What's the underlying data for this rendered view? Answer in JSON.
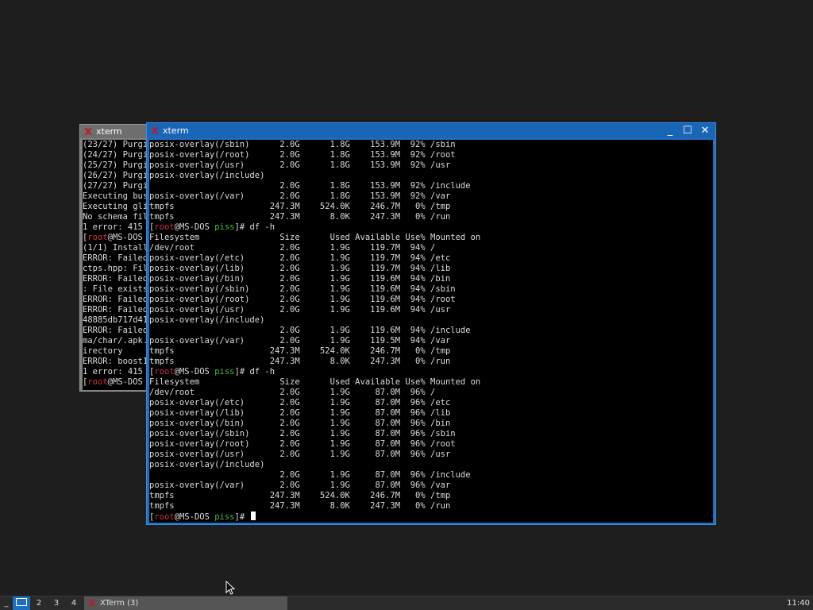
{
  "back_window": {
    "title": "xterm",
    "lines": [
      "(23/27) Purgi",
      "(24/27) Purgi",
      "(25/27) Purgi",
      "(26/27) Purgi",
      "(27/27) Purgi",
      "Executing bus",
      "Executing gli",
      "No schema fil",
      "1 error: 415",
      "[root@MS-DOS",
      "(1/1) Install",
      "ERROR: Failed",
      "ctps.hpp: Fil",
      "ERROR: Failed",
      ": File exists",
      "ERROR: Failed",
      "ERROR: Failed",
      "48885db717d41",
      "ERROR: Failed",
      "ma/char/.apk.",
      "irectory",
      "ERROR: boost1",
      "1 error: 415",
      "[root@MS-DOS"
    ]
  },
  "front_window": {
    "title": "xterm",
    "minimize": "_",
    "maximize": "☐",
    "close": "✕",
    "prompt": {
      "user": "root",
      "host": "MS-DOS",
      "dir": "piss"
    },
    "lines": [
      "posix-overlay(/sbin)      2.0G      1.8G    153.9M  92% /sbin",
      "posix-overlay(/root)      2.0G      1.8G    153.9M  92% /root",
      "posix-overlay(/usr)       2.0G      1.8G    153.9M  92% /usr",
      "posix-overlay(/include)",
      "                          2.0G      1.8G    153.9M  92% /include",
      "posix-overlay(/var)       2.0G      1.8G    153.9M  92% /var",
      "tmpfs                   247.3M    524.0K    246.7M   0% /tmp",
      "tmpfs                   247.3M      8.0K    247.3M   0% /run",
      "__PROMPT__# df -h",
      "Filesystem                Size      Used Available Use% Mounted on",
      "/dev/root                 2.0G      1.9G    119.7M  94% /",
      "posix-overlay(/etc)       2.0G      1.9G    119.7M  94% /etc",
      "posix-overlay(/lib)       2.0G      1.9G    119.7M  94% /lib",
      "posix-overlay(/bin)       2.0G      1.9G    119.6M  94% /bin",
      "posix-overlay(/sbin)      2.0G      1.9G    119.6M  94% /sbin",
      "posix-overlay(/root)      2.0G      1.9G    119.6M  94% /root",
      "posix-overlay(/usr)       2.0G      1.9G    119.6M  94% /usr",
      "posix-overlay(/include)",
      "                          2.0G      1.9G    119.6M  94% /include",
      "posix-overlay(/var)       2.0G      1.9G    119.5M  94% /var",
      "tmpfs                   247.3M    524.0K    246.7M   0% /tmp",
      "tmpfs                   247.3M      8.0K    247.3M   0% /run",
      "__PROMPT__# df -h",
      "Filesystem                Size      Used Available Use% Mounted on",
      "/dev/root                 2.0G      1.9G     87.0M  96% /",
      "posix-overlay(/etc)       2.0G      1.9G     87.0M  96% /etc",
      "posix-overlay(/lib)       2.0G      1.9G     87.0M  96% /lib",
      "posix-overlay(/bin)       2.0G      1.9G     87.0M  96% /bin",
      "posix-overlay(/sbin)      2.0G      1.9G     87.0M  96% /sbin",
      "posix-overlay(/root)      2.0G      1.9G     87.0M  96% /root",
      "posix-overlay(/usr)       2.0G      1.9G     87.0M  96% /usr",
      "posix-overlay(/include)",
      "                          2.0G      1.9G     87.0M  96% /include",
      "posix-overlay(/var)       2.0G      1.9G     87.0M  96% /var",
      "tmpfs                   247.3M    524.0K    246.7M   0% /tmp",
      "tmpfs                   247.3M      8.0K    247.3M   0% /run",
      "__PROMPT__# __CURSOR__"
    ]
  },
  "taskbar": {
    "menu_label": "_",
    "workspaces": [
      "1",
      "2",
      "3",
      "4"
    ],
    "active_workspace": "1",
    "task_label": "XTerm (3)",
    "clock": "11:40"
  },
  "colors": {
    "accent": "#1f6fbf",
    "desktop": "#1e1e1e",
    "prompt_user_host": "#d0343c",
    "prompt_dir": "#3cc03c"
  }
}
